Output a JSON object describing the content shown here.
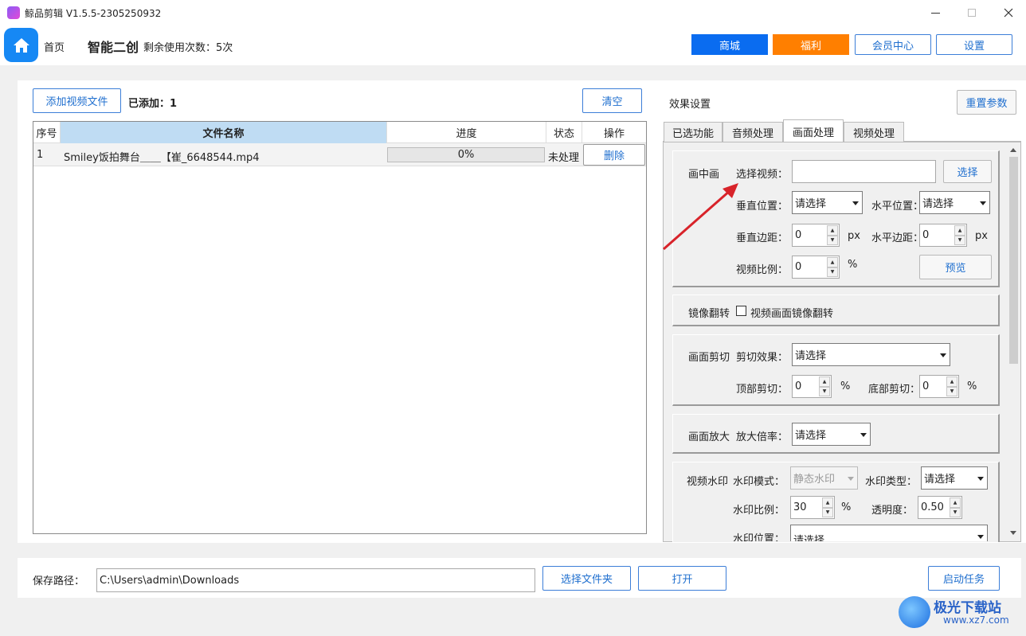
{
  "window": {
    "title": "鲸品剪辑 V1.5.5-2305250932"
  },
  "header": {
    "home": "首页",
    "mode": "智能二创",
    "remaining": "剩余使用次数：5次",
    "shop": "商城",
    "welfare": "福利",
    "member": "会员中心",
    "settings": "设置"
  },
  "left": {
    "add_btn": "添加视频文件",
    "added": "已添加：1",
    "clear": "清空",
    "columns": [
      "序号",
      "文件名称",
      "进度",
      "状态",
      "操作"
    ],
    "rows": [
      {
        "no": "1",
        "name": "Smiley饭拍舞台＿＿【崔_6648544.mp4",
        "progress": "0%",
        "progress_value": 0,
        "status": "未处理",
        "action": "删除"
      }
    ]
  },
  "right": {
    "title": "效果设置",
    "reset": "重置参数",
    "tabs": [
      "已选功能",
      "音频处理",
      "画面处理",
      "视频处理"
    ],
    "active_tab": "画面处理",
    "pip": {
      "section": "画中画",
      "select_video": "选择视频：",
      "video_value": "",
      "select_btn": "选择",
      "vpos": "垂直位置：",
      "vpos_val": "请选择",
      "hpos": "水平位置：",
      "hpos_val": "请选择",
      "vmargin": "垂直边距：",
      "vmargin_val": "0",
      "px1": "px",
      "hmargin": "水平边距：",
      "hmargin_val": "0",
      "px2": "px",
      "ratio": "视频比例：",
      "ratio_val": "0",
      "pct": "%",
      "preview": "预览"
    },
    "mirror": {
      "section": "镜像翻转",
      "check_label": "视频画面镜像翻转"
    },
    "crop": {
      "section": "画面剪切",
      "effect": "剪切效果：",
      "effect_val": "请选择",
      "top": "顶部剪切：",
      "top_val": "0",
      "pct1": "%",
      "bottom": "底部剪切：",
      "bottom_val": "0",
      "pct2": "%"
    },
    "zoom": {
      "section": "画面放大",
      "rate": "放大倍率：",
      "rate_val": "请选择"
    },
    "watermark": {
      "section": "视频水印",
      "mode": "水印模式：",
      "mode_val": "静态水印",
      "type": "水印类型：",
      "type_val": "请选择",
      "ratio": "水印比例：",
      "ratio_val": "30",
      "pct": "%",
      "opacity": "透明度：",
      "opacity_val": "0.50",
      "pos": "水印位置：",
      "pos_val": "请选择"
    }
  },
  "footer": {
    "save_label": "保存路径：",
    "path": "C:\\Users\\admin\\Downloads",
    "choose_folder": "选择文件夹",
    "open": "打开",
    "start": "启动任务"
  },
  "watermark_logo": {
    "cn": "极光下载站",
    "url": "www.xz7.com"
  },
  "colors": {
    "blue": "#0a6cf0",
    "orange": "#ff7f00",
    "header_sel": "#bfdcf3"
  }
}
